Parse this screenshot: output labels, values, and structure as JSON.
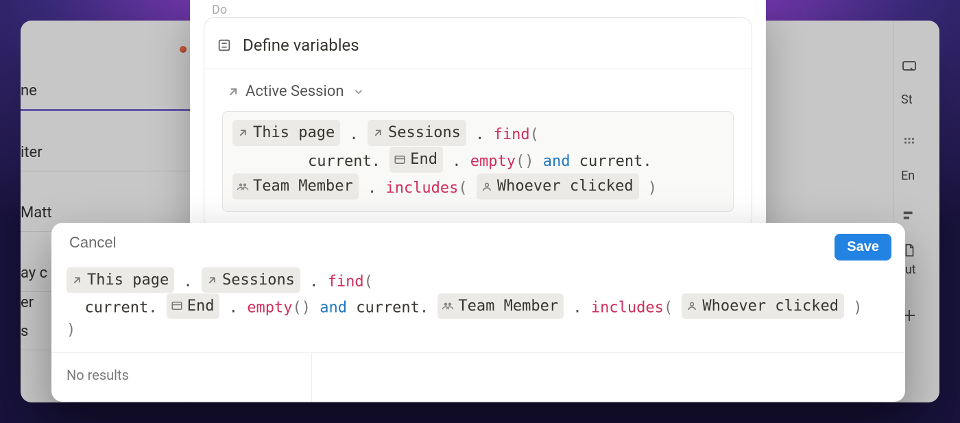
{
  "bg": {
    "sidebar": {
      "items": [
        "ne",
        "iter",
        "Matt",
        "ay c",
        "er",
        "s"
      ]
    },
    "right_rail": {
      "labels": [
        "St",
        "En",
        "tut"
      ]
    }
  },
  "panel": {
    "do_label": "Do",
    "step_title": "Define variables",
    "variable_name": "Active Session",
    "formula": {
      "this_page": "This page",
      "sessions": "Sessions",
      "find": "find",
      "current": "current",
      "end": "End",
      "empty": "empty",
      "and": "and",
      "team_member": "Team Member",
      "includes": "includes",
      "whoever_clicked": "Whoever clicked"
    }
  },
  "editor": {
    "cancel": "Cancel",
    "save": "Save",
    "no_results": "No results",
    "formula": {
      "this_page": "This page",
      "sessions": "Sessions",
      "find": "find",
      "current": "current",
      "end": "End",
      "empty": "empty",
      "and": "and",
      "team_member": "Team Member",
      "includes": "includes",
      "whoever_clicked": "Whoever clicked"
    }
  },
  "colors": {
    "accent": "#2383e2",
    "fn": "#cf2e5b",
    "kw": "#1f78c1"
  }
}
